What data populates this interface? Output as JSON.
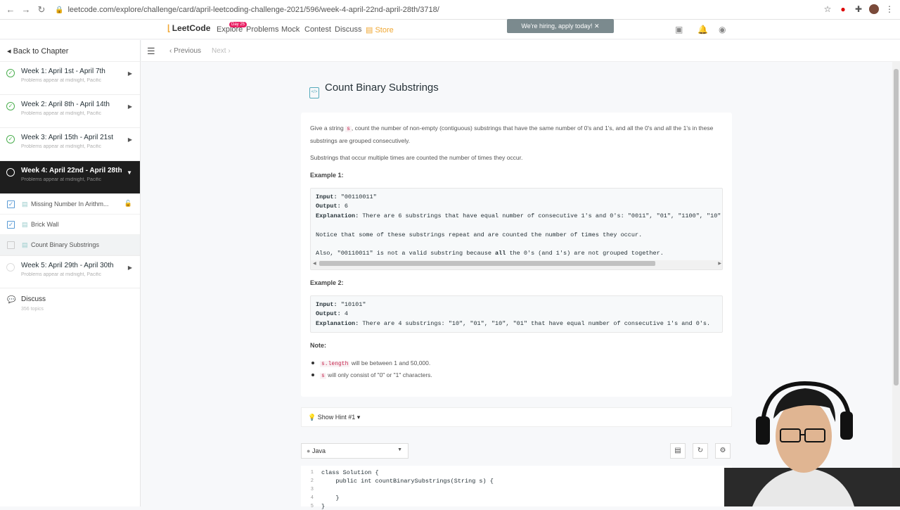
{
  "browser": {
    "url": "leetcode.com/explore/challenge/card/april-leetcoding-challenge-2021/596/week-4-april-22nd-april-28th/3718/"
  },
  "topnav": {
    "logo": "LeetCode",
    "explore": "Explore",
    "badge": "Day 25",
    "problems": "Problems",
    "mock": "Mock",
    "contest": "Contest",
    "discuss": "Discuss",
    "store": "Store",
    "hiring": "We're hiring, apply today!"
  },
  "sidebar": {
    "back": "Back to Chapter",
    "weeks": [
      {
        "title": "Week 1: April 1st - April 7th",
        "sub": "Problems appear at midnight, Pacific"
      },
      {
        "title": "Week 2: April 8th - April 14th",
        "sub": "Problems appear at midnight, Pacific"
      },
      {
        "title": "Week 3: April 15th - April 21st",
        "sub": "Problems appear at midnight, Pacific"
      },
      {
        "title": "Week 4: April 22nd - April 28th",
        "sub": "Problems appear at midnight, Pacific"
      },
      {
        "title": "Week 5: April 29th - April 30th",
        "sub": "Problems appear at midnight, Pacific"
      }
    ],
    "problems": [
      {
        "title": "Missing Number In Arithm..."
      },
      {
        "title": "Brick Wall"
      },
      {
        "title": "Count Binary Substrings"
      }
    ],
    "discuss": {
      "title": "Discuss",
      "sub": "356 topics"
    }
  },
  "subbar": {
    "previous": "Previous",
    "next": "Next"
  },
  "problem": {
    "title": "Count Binary Substrings",
    "desc_a": "Give a string ",
    "desc_s": "s",
    "desc_b": ", count the number of non-empty (contiguous) substrings that have the same number of 0's and 1's, and all the 0's and all the 1's in these substrings are grouped consecutively.",
    "desc2": "Substrings that occur multiple times are counted the number of times they occur.",
    "example1_label": "Example 1:",
    "ex1": {
      "input_label": "Input:",
      "input": "\"00110011\"",
      "output_label": "Output:",
      "output": "6",
      "expl_label": "Explanation:",
      "expl": "There are 6 substrings that have equal number of consecutive 1's and 0's: \"0011\", \"01\", \"1100\", \"10\"",
      "notice": "Notice that some of these substrings repeat and are counted the number of times they occur.",
      "also_a": "Also, \"00110011\" is not a valid substring because ",
      "also_bold": "all",
      "also_b": " the 0's (and 1's) are not grouped together."
    },
    "example2_label": "Example 2:",
    "ex2": {
      "input_label": "Input:",
      "input": "\"10101\"",
      "output_label": "Output:",
      "output": "4",
      "expl_label": "Explanation:",
      "expl": "There are 4 substrings: \"10\", \"01\", \"10\", \"01\" that have equal number of consecutive 1's and 0's."
    },
    "note_label": "Note:",
    "notes": [
      {
        "code": "s.length",
        "text": " will be between 1 and 50,000."
      },
      {
        "code": "s",
        "text": " will only consist of \"0\" or \"1\" characters."
      }
    ]
  },
  "hint": "Show Hint #1",
  "language": "Java",
  "code": [
    "class Solution {",
    "    public int countBinarySubstrings(String s) {",
    "",
    "    }",
    "}"
  ],
  "line_numbers": [
    "1",
    "2",
    "3",
    "4",
    "5"
  ]
}
